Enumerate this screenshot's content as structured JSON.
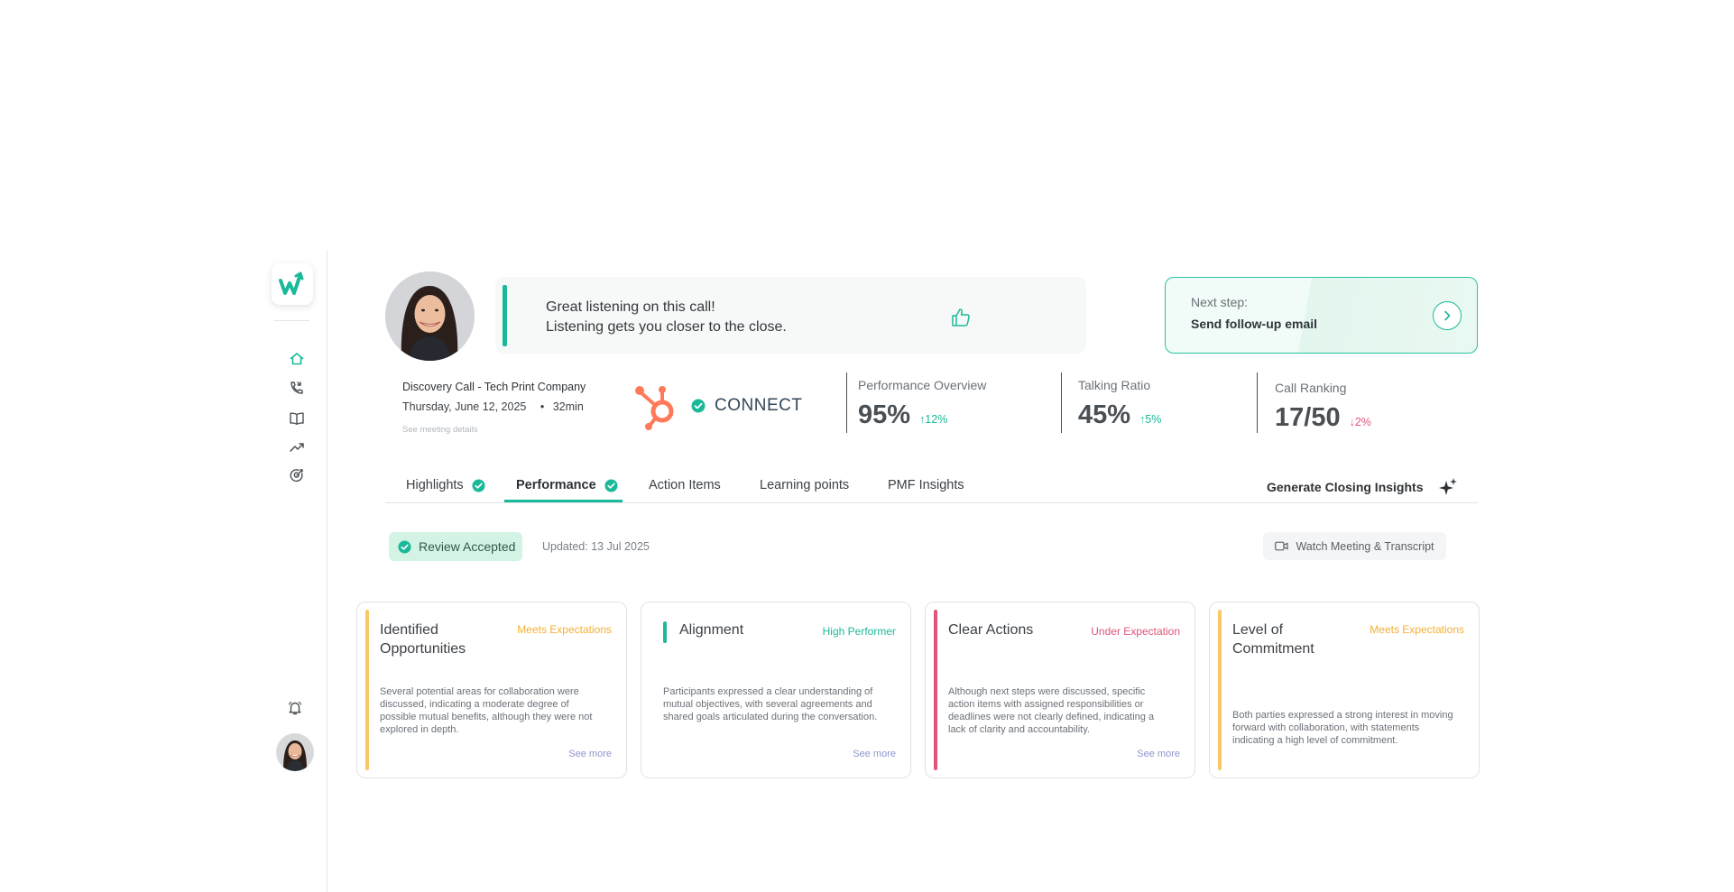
{
  "sidebar": {
    "logo_text": "w",
    "nav": [
      {
        "name": "home",
        "icon": "home-icon",
        "active": true
      },
      {
        "name": "calls",
        "icon": "phone-icon"
      },
      {
        "name": "library",
        "icon": "book-icon"
      },
      {
        "name": "trends",
        "icon": "trending-up-icon"
      },
      {
        "name": "goals",
        "icon": "target-icon"
      }
    ],
    "bottom": [
      {
        "name": "notifications",
        "icon": "bell-icon"
      },
      {
        "name": "profile",
        "icon": "avatar"
      }
    ]
  },
  "banner": {
    "praise_line1": "Great listening on this call!",
    "praise_line2": "Listening gets you closer to the close.",
    "next_step_label": "Next step:",
    "next_step_value": "Send follow-up email"
  },
  "meeting": {
    "title": "Discovery Call - Tech Print Company",
    "date": "Thursday, June 12, 2025",
    "bullet": "•",
    "duration": "32min",
    "details_link": "See meeting details"
  },
  "crm": {
    "connect_label": "CONNECT"
  },
  "metrics": [
    {
      "label": "Performance Overview",
      "value": "95%",
      "delta": "12%",
      "direction": "up"
    },
    {
      "label": "Talking Ratio",
      "value": "45%",
      "delta": "5%",
      "direction": "up"
    },
    {
      "label": "Call Ranking",
      "value": "17/50",
      "delta": "2%",
      "direction": "down"
    }
  ],
  "tabs": [
    {
      "label": "Highlights",
      "checked": true
    },
    {
      "label": "Performance",
      "checked": true,
      "active": true
    },
    {
      "label": "Action Items"
    },
    {
      "label": "Learning points"
    },
    {
      "label": "PMF Insights"
    }
  ],
  "generate_insights": "Generate Closing Insights",
  "review": {
    "badge": "Review Accepted",
    "updated": "Updated: 13 Jul 2025",
    "watch_label": "Watch Meeting & Transcript"
  },
  "cards": [
    {
      "title": "Identified Opportunities",
      "status": "Meets Expectations",
      "status_color": "#f5b031",
      "body": "Several potential areas for collaboration were discussed, indicating a moderate degree of possible mutual benefits, although they were not explored in depth.",
      "more": "See more"
    },
    {
      "title": "Alignment",
      "status": "High Performer",
      "status_color": "#1bb99a",
      "body": "Participants expressed a clear understanding of mutual objectives, with several agreements and shared goals articulated during the conversation.",
      "more": "See more"
    },
    {
      "title": "Clear Actions",
      "status": "Under Expectation",
      "status_color": "#e0557a",
      "body": "Although next steps were discussed, specific action items with assigned responsibilities or deadlines were not clearly defined, indicating a lack of clarity and accountability.",
      "more": "See more"
    },
    {
      "title": "Level of Commitment",
      "status": "Meets Expectations",
      "status_color": "#f5b031",
      "body": "Both parties expressed a strong interest in moving forward with collaboration, with statements indicating a high level of commitment.",
      "more": ""
    }
  ],
  "colors": {
    "accent": "#1bb99a",
    "warning": "#f5b031",
    "danger": "#e0557a",
    "hubspot": "#ff7a59"
  }
}
